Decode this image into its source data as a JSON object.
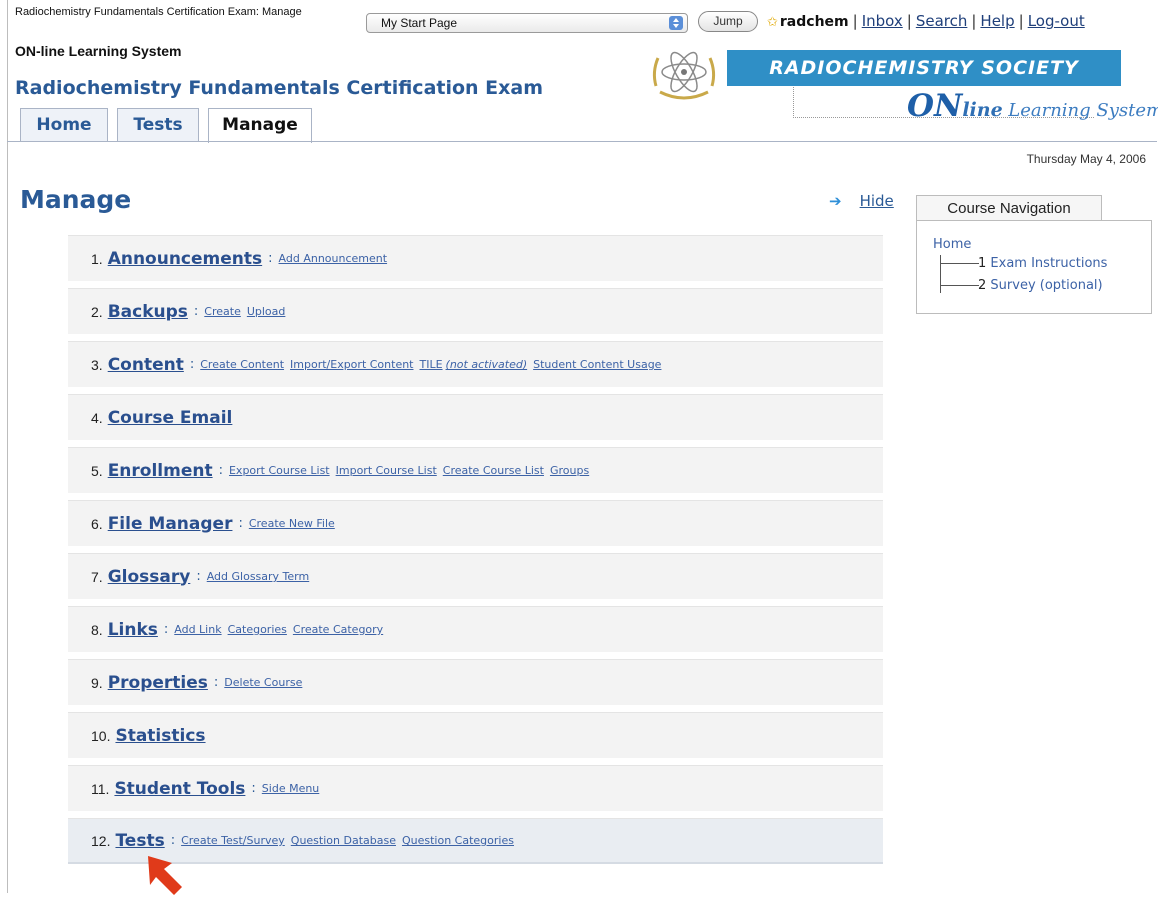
{
  "window": {
    "title": "Radiochemistry Fundamentals Certification Exam: Manage"
  },
  "jump": {
    "selected": "My Start Page",
    "button": "Jump"
  },
  "user": {
    "name": "radchem",
    "links": [
      "Inbox",
      "Search",
      "Help",
      "Log-out"
    ]
  },
  "header": {
    "system_name": "ON-line Learning System",
    "course_title": "Radiochemistry Fundamentals Certification Exam",
    "banner": "RADIOCHEMISTRY SOCIETY",
    "online_logo": {
      "on": "ON",
      "line": "line",
      "ls": "Learning System"
    }
  },
  "tabs": [
    {
      "label": "Home"
    },
    {
      "label": "Tests"
    },
    {
      "label": "Manage",
      "active": true
    }
  ],
  "date": "Thursday May 4, 2006",
  "page": {
    "heading": "Manage",
    "hide": "Hide"
  },
  "manage_items": [
    {
      "num": "1.",
      "title": "Announcements",
      "subs": [
        "Add Announcement"
      ]
    },
    {
      "num": "2.",
      "title": "Backups",
      "subs": [
        "Create",
        "Upload"
      ]
    },
    {
      "num": "3.",
      "title": "Content",
      "subs": [
        "Create Content",
        "Import/Export Content",
        "TILE",
        "(not activated)",
        "Student Content Usage"
      ]
    },
    {
      "num": "4.",
      "title": "Course Email",
      "subs": []
    },
    {
      "num": "5.",
      "title": "Enrollment",
      "subs": [
        "Export Course List",
        "Import Course List",
        "Create Course List",
        "Groups"
      ]
    },
    {
      "num": "6.",
      "title": "File Manager",
      "subs": [
        "Create New File"
      ]
    },
    {
      "num": "7.",
      "title": "Glossary",
      "subs": [
        "Add Glossary Term"
      ]
    },
    {
      "num": "8.",
      "title": "Links",
      "subs": [
        "Add Link",
        "Categories",
        "Create Category"
      ]
    },
    {
      "num": "9.",
      "title": "Properties",
      "subs": [
        "Delete Course"
      ]
    },
    {
      "num": "10.",
      "title": "Statistics",
      "subs": []
    },
    {
      "num": "11.",
      "title": "Student Tools",
      "subs": [
        "Side Menu"
      ]
    },
    {
      "num": "12.",
      "title": "Tests",
      "subs": [
        "Create Test/Survey",
        "Question Database",
        "Question Categories"
      ]
    }
  ],
  "course_nav": {
    "title": "Course Navigation",
    "home": "Home",
    "items": [
      {
        "num": "1",
        "label": "Exam Instructions"
      },
      {
        "num": "2",
        "label": "Survey (optional)"
      }
    ]
  },
  "colors": {
    "accent": "#2a5a96",
    "banner": "#2f8fc6",
    "pointer_arrow": "#e03a1a"
  },
  "icons": {
    "jump_arrows": "select-arrows-icon",
    "user": "star-icon",
    "hide": "right-arrow-icon",
    "pointer": "red-pointer-arrow-icon",
    "atom": "atom-logo-icon"
  }
}
